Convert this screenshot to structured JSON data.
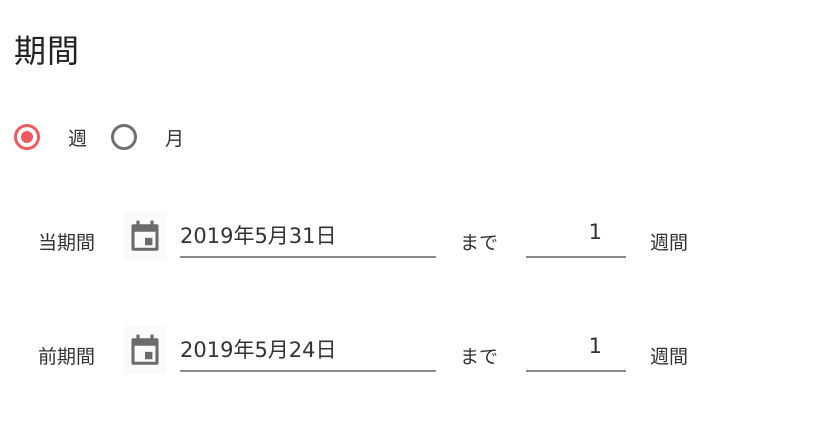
{
  "title": "期間",
  "period_type": {
    "options": [
      {
        "label": "週",
        "checked": true
      },
      {
        "label": "月",
        "checked": false
      }
    ]
  },
  "rows": [
    {
      "label": "当期間",
      "date": "2019年5月31日",
      "until": "まで",
      "count": "1",
      "unit": "週間"
    },
    {
      "label": "前期間",
      "date": "2019年5月24日",
      "until": "まで",
      "count": "1",
      "unit": "週間"
    }
  ],
  "colors": {
    "accent": "#f05a5e",
    "icon": "#6b6b6b",
    "underline": "#8a8a8a"
  },
  "icons": {
    "calendar": "calendar-icon"
  }
}
